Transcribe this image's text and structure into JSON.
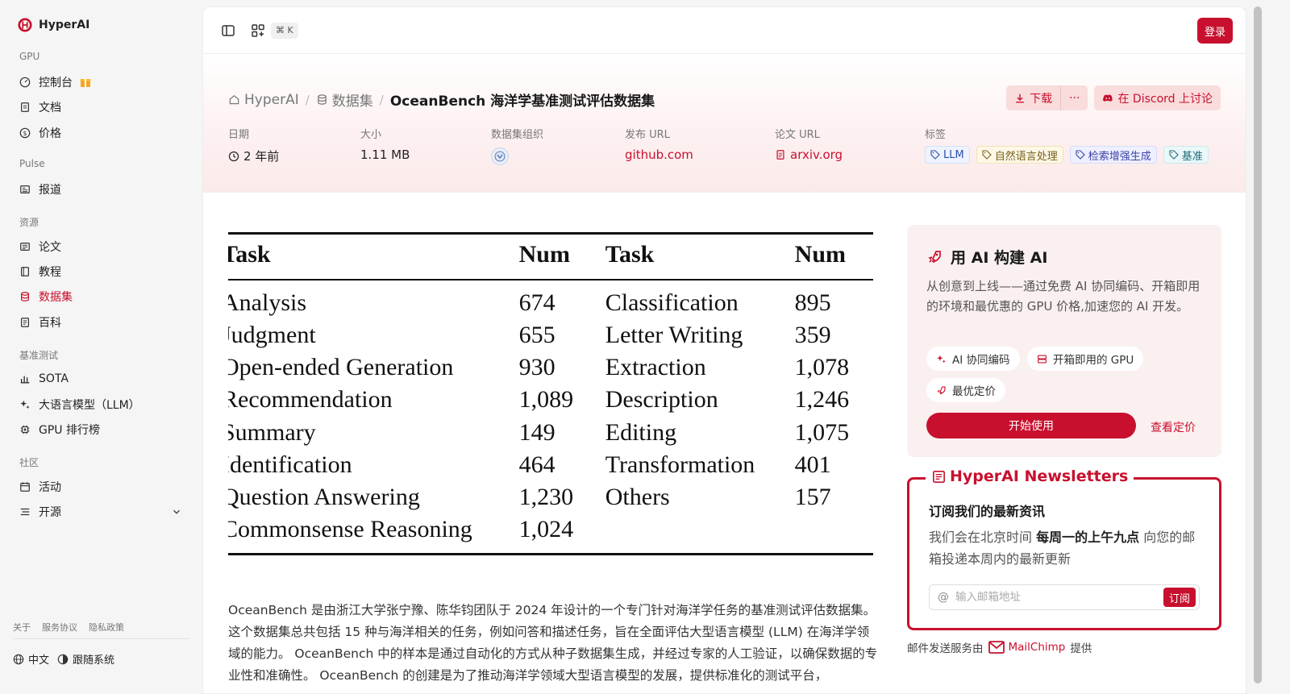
{
  "brand": {
    "name": "HyperAI"
  },
  "sidebar": {
    "sections": {
      "gpu": "GPU",
      "pulse": "Pulse",
      "resources": "资源",
      "benchmarks": "基准测试",
      "community": "社区"
    },
    "items": {
      "console": "控制台",
      "docs": "文档",
      "pricing": "价格",
      "news": "报道",
      "papers": "论文",
      "tutorials": "教程",
      "datasets": "数据集",
      "wiki": "百科",
      "sota": "SOTA",
      "llm": "大语言模型（LLM）",
      "gpu_leaderboard": "GPU 排行榜",
      "events": "活动",
      "opensource": "开源"
    },
    "footer_links": [
      "关于",
      "服务协议",
      "隐私政策"
    ],
    "language": "中文",
    "theme": "跟随系统"
  },
  "topbar": {
    "shortcut": "⌘ K",
    "login_label": "登录"
  },
  "breadcrumb": {
    "home": "HyperAI",
    "section": "数据集",
    "current": "OceanBench 海洋学基准测试评估数据集"
  },
  "actions": {
    "download": "下载",
    "more": "···",
    "discord": "在 Discord 上讨论"
  },
  "meta": {
    "date_label": "日期",
    "date_value": "2 年前",
    "size_label": "大小",
    "size_value": "1.11 MB",
    "org_label": "数据集组织",
    "release_url_label": "发布 URL",
    "release_url_value": "github.com",
    "paper_url_label": "论文 URL",
    "paper_url_value": "arxiv.org",
    "tags_label": "标签",
    "tags": [
      "LLM",
      "自然语言处理",
      "检索增强生成",
      "基准"
    ]
  },
  "task_table": {
    "headers": [
      "Task",
      "Num",
      "Task",
      "Num"
    ],
    "rows": [
      [
        "Analysis",
        "674",
        "Classification",
        "895"
      ],
      [
        "Judgment",
        "655",
        "Letter Writing",
        "359"
      ],
      [
        "Open-ended Generation",
        "930",
        "Extraction",
        "1,078"
      ],
      [
        "Recommendation",
        "1,089",
        "Description",
        "1,246"
      ],
      [
        "Summary",
        "149",
        "Editing",
        "1,075"
      ],
      [
        "Identification",
        "464",
        "Transformation",
        "401"
      ],
      [
        "Question Answering",
        "1,230",
        "Others",
        "157"
      ],
      [
        "Commonsense Reasoning",
        "1,024",
        "",
        ""
      ]
    ]
  },
  "description": "OceanBench 是由浙江大学张宁豫、陈华钧团队于 2024 年设计的一个专门针对海洋学任务的基准测试评估数据集。这个数据集总共包括 15 种与海洋相关的任务，例如问答和描述任务，旨在全面评估大型语言模型 (LLM) 在海洋学领域的能力。 OceanBench 中的样本是通过自动化的方式从种子数据集生成，并经过专家的人工验证，以确保数据的专业性和准确性。 OceanBench 的创建是为了推动海洋学领域大型语言模型的发展，提供标准化的测试平台，",
  "promo": {
    "title": "用 AI 构建 AI",
    "description": "从创意到上线——通过免费 AI 协同编码、开箱即用的环境和最优惠的 GPU 价格,加速您的 AI 开发。",
    "chips": [
      "AI 协同编码",
      "开箱即用的 GPU",
      "最优定价"
    ],
    "start_label": "开始使用",
    "pricing_label": "查看定价"
  },
  "newsletter": {
    "title": "HyperAI Newsletters",
    "heading": "订阅我们的最新资讯",
    "desc_before": "我们会在北京时间 ",
    "desc_bold": "每周一的上午九点",
    "desc_after": " 向您的邮箱投递本周内的最新更新",
    "email_placeholder": "输入邮箱地址",
    "subscribe_label": "订阅",
    "provider_before": "邮件发送服务由",
    "provider_name": "MailChimp",
    "provider_after": "提供"
  },
  "colors": {
    "accent": "#c8102e",
    "sidebar_bg": "#f5f5f5"
  }
}
